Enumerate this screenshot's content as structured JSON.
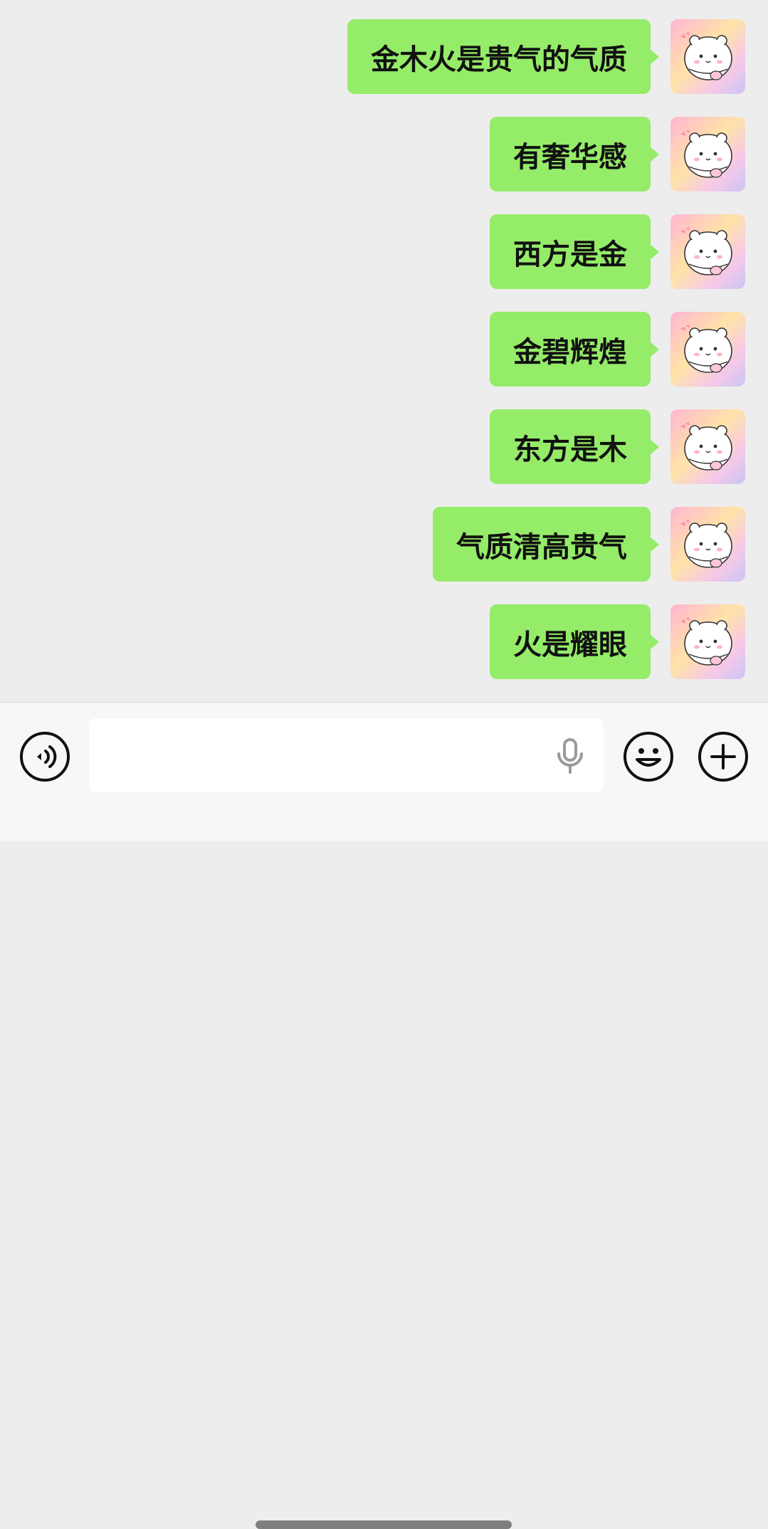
{
  "messages": [
    {
      "text": "金木火是贵气的气质",
      "sender": "self"
    },
    {
      "text": "有奢华感",
      "sender": "self"
    },
    {
      "text": "西方是金",
      "sender": "self"
    },
    {
      "text": "金碧辉煌",
      "sender": "self"
    },
    {
      "text": "东方是木",
      "sender": "self"
    },
    {
      "text": "气质清高贵气",
      "sender": "self"
    },
    {
      "text": "火是耀眼",
      "sender": "self"
    }
  ],
  "input": {
    "value": "",
    "placeholder": ""
  },
  "icons": {
    "voice": "voice-toggle-icon",
    "mic": "microphone-icon",
    "emoji": "emoji-icon",
    "plus": "plus-icon"
  },
  "colors": {
    "bubble": "#95ec69",
    "background": "#ededed",
    "input_bar": "#f7f7f7"
  }
}
